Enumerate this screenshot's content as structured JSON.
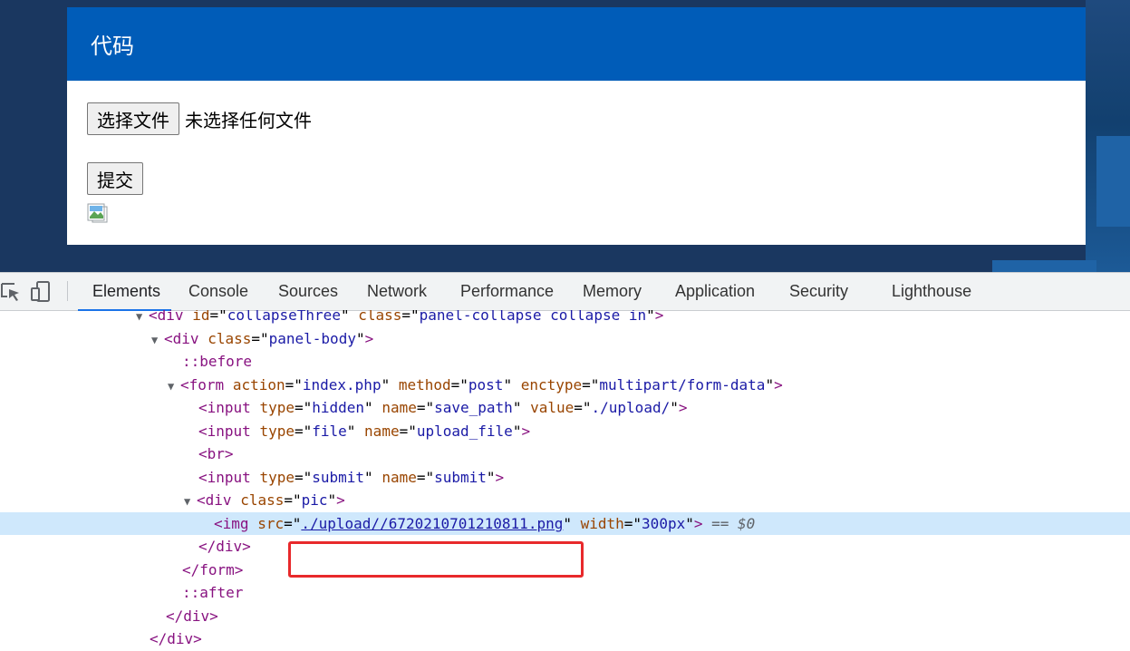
{
  "page": {
    "panel_title": "代码",
    "choose_file_label": "选择文件",
    "file_status": "未选择任何文件",
    "submit_label": "提交"
  },
  "devtools": {
    "tabs": [
      "Elements",
      "Console",
      "Sources",
      "Network",
      "Performance",
      "Memory",
      "Application",
      "Security",
      "Lighthouse"
    ],
    "active_tab": "Elements",
    "icons": [
      "inspect-element-icon",
      "device-toolbar-icon"
    ],
    "dom": {
      "l0": {
        "tag": "div",
        "id_attr": "id",
        "id_val": "collapseThree",
        "class_attr": "class",
        "class_val": "panel-collapse collapse in"
      },
      "l1": {
        "tag": "div",
        "class_attr": "class",
        "class_val": "panel-body"
      },
      "l2": {
        "pseudo": "::before"
      },
      "l3": {
        "tag": "form",
        "a1": "action",
        "v1": "index.php",
        "a2": "method",
        "v2": "post",
        "a3": "enctype",
        "v3": "multipart/form-data"
      },
      "l4": {
        "tag": "input",
        "a1": "type",
        "v1": "hidden",
        "a2": "name",
        "v2": "save_path",
        "a3": "value",
        "v3": "./upload/"
      },
      "l5": {
        "tag": "input",
        "a1": "type",
        "v1": "file",
        "a2": "name",
        "v2": "upload_file"
      },
      "l6": {
        "tag": "br"
      },
      "l7": {
        "tag": "input",
        "a1": "type",
        "v1": "submit",
        "a2": "name",
        "v2": "submit"
      },
      "l8": {
        "tag": "div",
        "a1": "class",
        "v1": "pic"
      },
      "l9": {
        "tag": "img",
        "a1": "src",
        "v1": "./upload//6720210701210811.png",
        "a2": "width",
        "v2": "300px",
        "eq": "== ",
        "dollar": "$0"
      },
      "l10": {
        "close": "</div>"
      },
      "l11": {
        "close": "</form>"
      },
      "l12": {
        "pseudo": "::after"
      },
      "l13": {
        "close": "</div>"
      },
      "l14": {
        "close": "</div>"
      }
    },
    "highlight_color": "#e8292b",
    "selected_row_color": "#cfe8fc"
  }
}
